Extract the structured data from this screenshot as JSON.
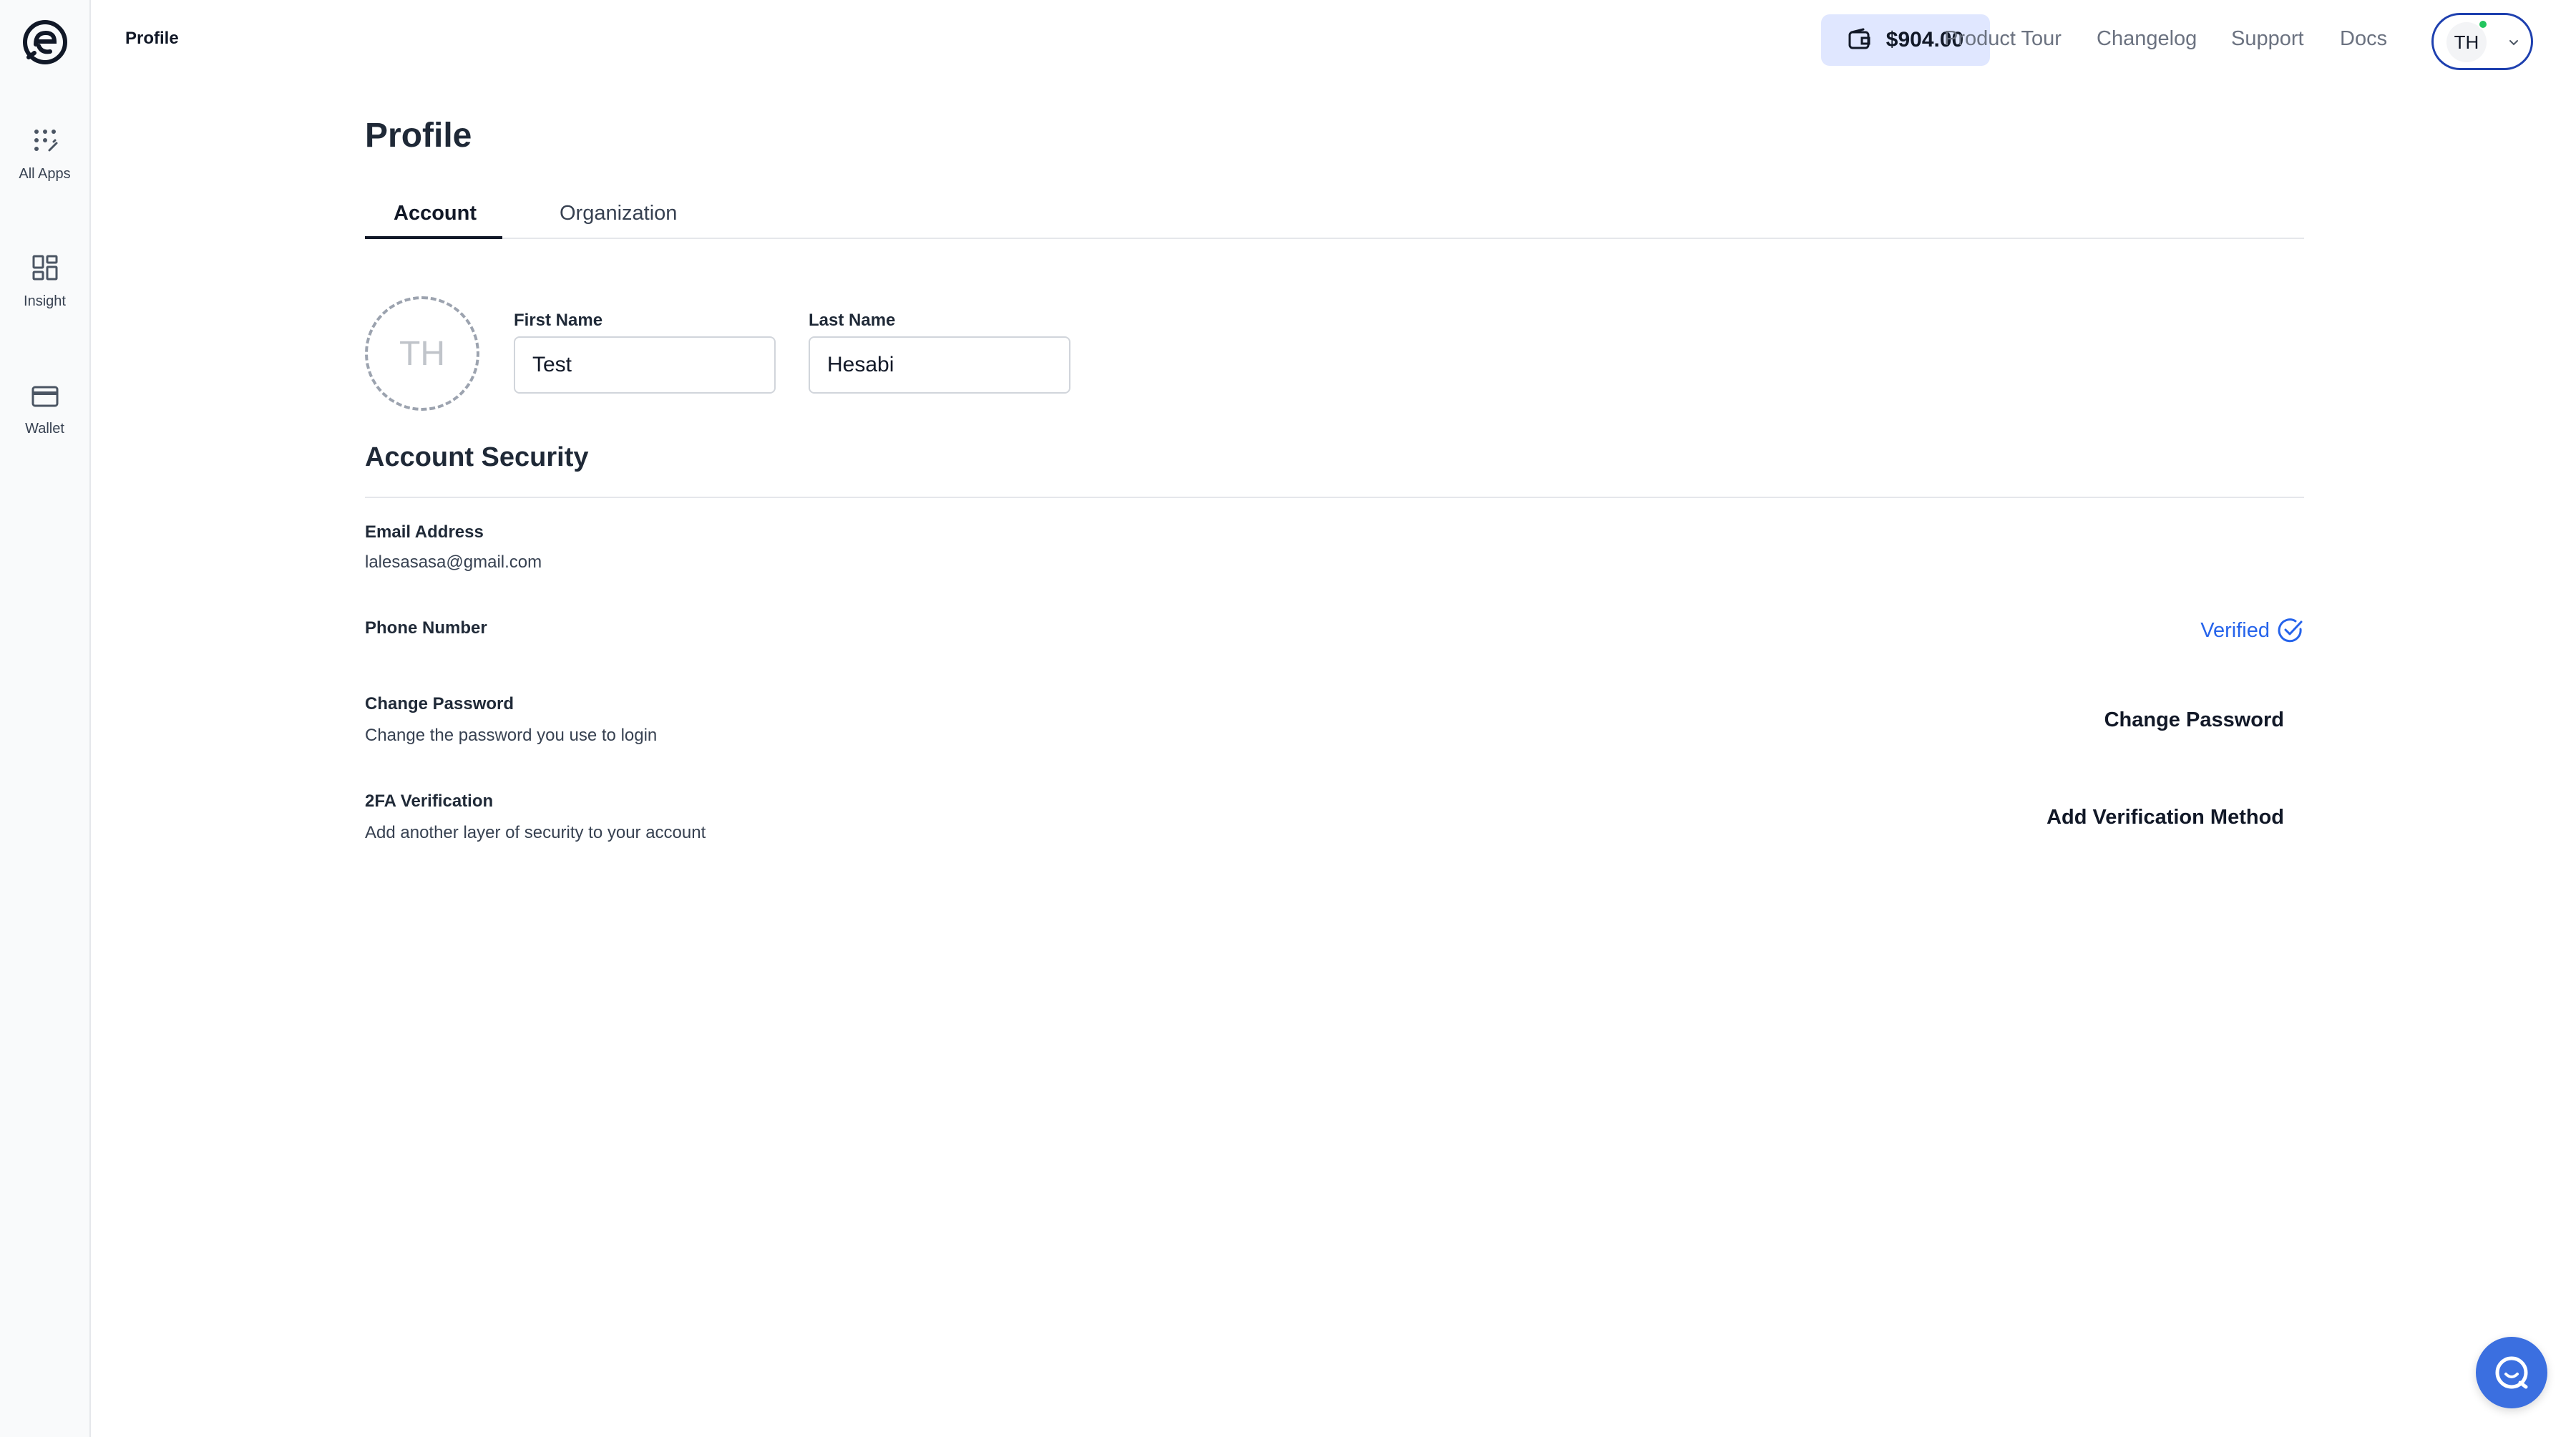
{
  "sidebar": {
    "logo": "brand-e-logo",
    "items": [
      {
        "label": "All Apps",
        "icon": "apps-sparkle-icon"
      },
      {
        "label": "Insight",
        "icon": "dashboard-grid-icon"
      },
      {
        "label": "Wallet",
        "icon": "card-icon"
      }
    ]
  },
  "header": {
    "breadcrumb": "Profile",
    "wallet_balance": "$904.00",
    "links": [
      "Product Tour",
      "Changelog",
      "Support",
      "Docs"
    ],
    "user_initials": "TH"
  },
  "main": {
    "title": "Profile",
    "tabs": [
      {
        "label": "Account",
        "active": true
      },
      {
        "label": "Organization",
        "active": false
      }
    ],
    "avatar_initials": "TH",
    "first_name": {
      "label": "First Name",
      "value": "Test"
    },
    "last_name": {
      "label": "Last Name",
      "value": "Hesabi"
    },
    "security": {
      "title": "Account Security",
      "email_label": "Email Address",
      "email_value": "lalesasasa@gmail.com",
      "phone_label": "Phone Number",
      "phone_status": "Verified",
      "password_label": "Change Password",
      "password_desc": "Change the password you use to login",
      "password_action": "Change Password",
      "twofa_label": "2FA Verification",
      "twofa_desc": "Add another layer of security to your account",
      "twofa_action": "Add Verification Method"
    }
  },
  "colors": {
    "accent": "#2563eb",
    "wallet_bg": "#e0e7ff",
    "status_online": "#22c55e",
    "chat_button": "#3b6fe0"
  }
}
